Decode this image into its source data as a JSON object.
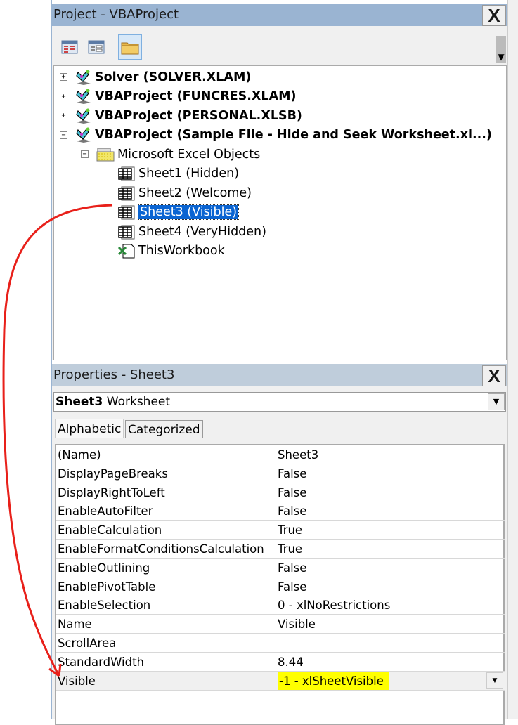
{
  "project": {
    "title": "Project - VBAProject",
    "close": "X",
    "toolbar": [
      {
        "icon": "view-code-icon"
      },
      {
        "icon": "view-object-icon"
      },
      {
        "icon": "toggle-folders-icon"
      }
    ],
    "tree": [
      {
        "label": "Solver (SOLVER.XLAM)",
        "level": 0,
        "expander": "+",
        "bold": true,
        "icon": "vba-project-icon"
      },
      {
        "label": "VBAProject (FUNCRES.XLAM)",
        "level": 0,
        "expander": "+",
        "bold": true,
        "icon": "vba-project-icon"
      },
      {
        "label": "VBAProject (PERSONAL.XLSB)",
        "level": 0,
        "expander": "+",
        "bold": true,
        "icon": "vba-project-icon"
      },
      {
        "label": "VBAProject (Sample File - Hide and Seek Worksheet.xl...)",
        "level": 0,
        "expander": "−",
        "bold": true,
        "icon": "vba-project-icon"
      },
      {
        "label": "Microsoft Excel Objects",
        "level": 1,
        "expander": "−",
        "icon": "folder-icon"
      },
      {
        "label": "Sheet1 (Hidden)",
        "level": 2,
        "icon": "worksheet-icon"
      },
      {
        "label": "Sheet2 (Welcome)",
        "level": 2,
        "icon": "worksheet-icon"
      },
      {
        "label": "Sheet3 (Visible)",
        "level": 2,
        "icon": "worksheet-icon",
        "selected": true
      },
      {
        "label": "Sheet4 (VeryHidden)",
        "level": 2,
        "icon": "worksheet-icon"
      },
      {
        "label": "ThisWorkbook",
        "level": 2,
        "icon": "workbook-icon"
      }
    ]
  },
  "properties": {
    "title": "Properties - Sheet3",
    "close": "X",
    "object_name": "Sheet3",
    "object_type": "Worksheet",
    "tabs": [
      "Alphabetic",
      "Categorized"
    ],
    "active_tab": "Alphabetic",
    "rows": [
      [
        "(Name)",
        "Sheet3"
      ],
      [
        "DisplayPageBreaks",
        "False"
      ],
      [
        "DisplayRightToLeft",
        "False"
      ],
      [
        "EnableAutoFilter",
        "False"
      ],
      [
        "EnableCalculation",
        "True"
      ],
      [
        "EnableFormatConditionsCalculation",
        "True"
      ],
      [
        "EnableOutlining",
        "False"
      ],
      [
        "EnablePivotTable",
        "False"
      ],
      [
        "EnableSelection",
        "0 - xlNoRestrictions"
      ],
      [
        "Name",
        "Visible"
      ],
      [
        "ScrollArea",
        ""
      ],
      [
        "StandardWidth",
        "8.44"
      ],
      [
        "Visible",
        "-1 - xlSheetVisible"
      ]
    ],
    "highlight_color": "#ffff00"
  },
  "annotation_color": "#e8201a"
}
